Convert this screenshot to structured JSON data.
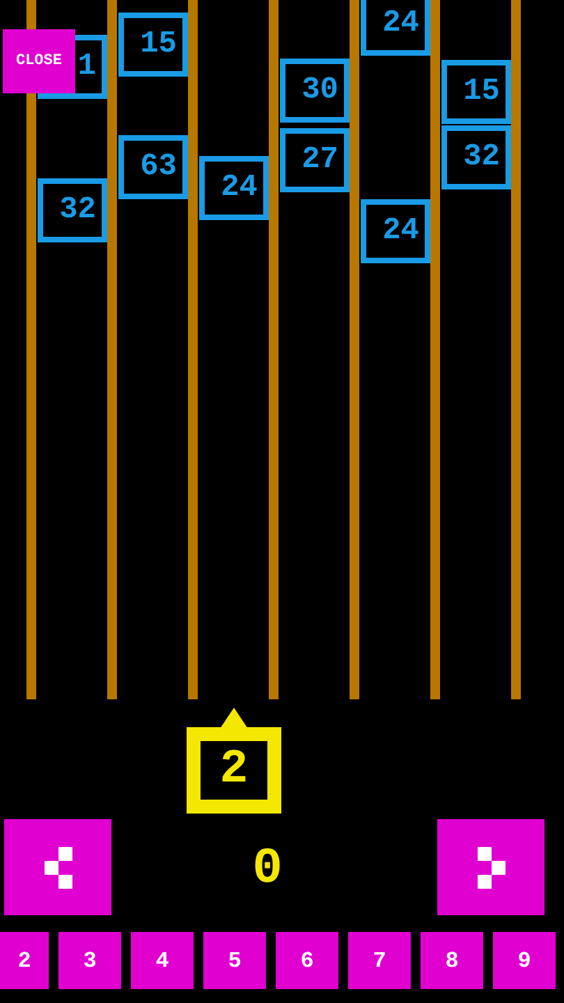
{
  "close_button": {
    "label": "CLOSE"
  },
  "blocks": [
    {
      "value": "1"
    },
    {
      "value": "15"
    },
    {
      "value": "32"
    },
    {
      "value": "63"
    },
    {
      "value": "24"
    },
    {
      "value": "30"
    },
    {
      "value": "27"
    },
    {
      "value": "24"
    },
    {
      "value": "24"
    },
    {
      "value": "15"
    },
    {
      "value": "32"
    }
  ],
  "shooter": {
    "value": "2"
  },
  "score": "0",
  "number_buttons": [
    "2",
    "3",
    "4",
    "5",
    "6",
    "7",
    "8",
    "9"
  ]
}
